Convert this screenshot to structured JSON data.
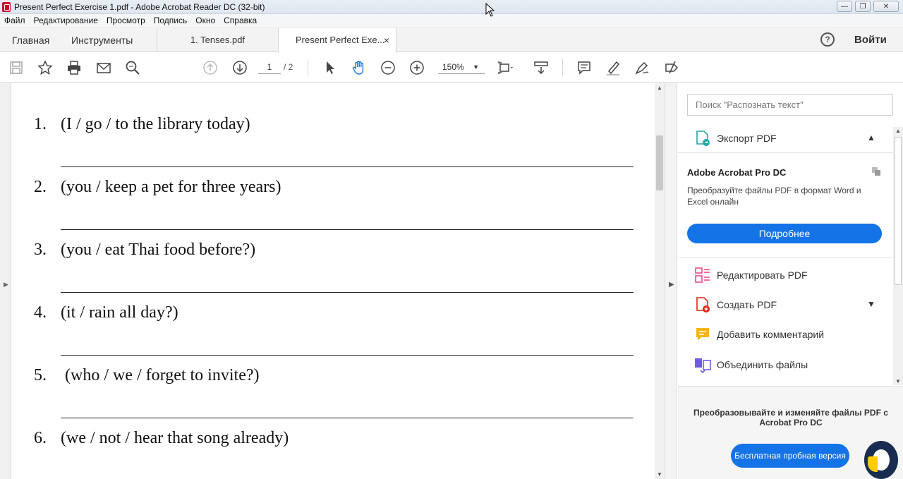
{
  "window": {
    "title": "Present Perfect Exercise 1.pdf - Adobe Acrobat Reader DC (32-bit)",
    "minimize": "—",
    "maximize": "❐",
    "close": "✕"
  },
  "menu": [
    "Файл",
    "Редактирование",
    "Просмотр",
    "Подпись",
    "Окно",
    "Справка"
  ],
  "tabs": {
    "home": "Главная",
    "tools": "Инструменты",
    "doc1": "1. Tenses.pdf",
    "doc2": "Present Perfect Exe...",
    "doc2_close": "×",
    "help": "?",
    "signin": "Войти"
  },
  "toolbar": {
    "page_current": "1",
    "page_total": "/ 2",
    "zoom": "150%",
    "zoom_caret": "▼"
  },
  "document": {
    "exercises": [
      {
        "num": "1.",
        "text": "(I / go / to the library today)"
      },
      {
        "num": "2.",
        "text": "(you / keep a pet for three years)"
      },
      {
        "num": "3.",
        "text": "(you / eat Thai food before?)"
      },
      {
        "num": "4.",
        "text": "(it / rain all day?)"
      },
      {
        "num": "5.",
        "text": " (who / we / forget to invite?)"
      },
      {
        "num": "6.",
        "text": "(we / not / hear that song already)"
      }
    ]
  },
  "rightpane": {
    "search_placeholder": "Поиск \"Распознать текст\"",
    "export_label": "Экспорт PDF",
    "promo_title": "Adobe Acrobat Pro DC",
    "promo_text": "Преобразуйте файлы PDF в формат Word и Excel онлайн",
    "more_button": "Подробнее",
    "tools": [
      {
        "label": "Редактировать PDF"
      },
      {
        "label": "Создать PDF"
      },
      {
        "label": "Добавить комментарий"
      },
      {
        "label": "Объединить файлы"
      }
    ],
    "bottom_text": "Преобразовывайте и изменяйте файлы PDF с Acrobat Pro DC",
    "trial_button": "Бесплатная пробная версия"
  },
  "colors": {
    "accent_blue": "#1473e6",
    "acrobat_red": "#c8102e"
  }
}
